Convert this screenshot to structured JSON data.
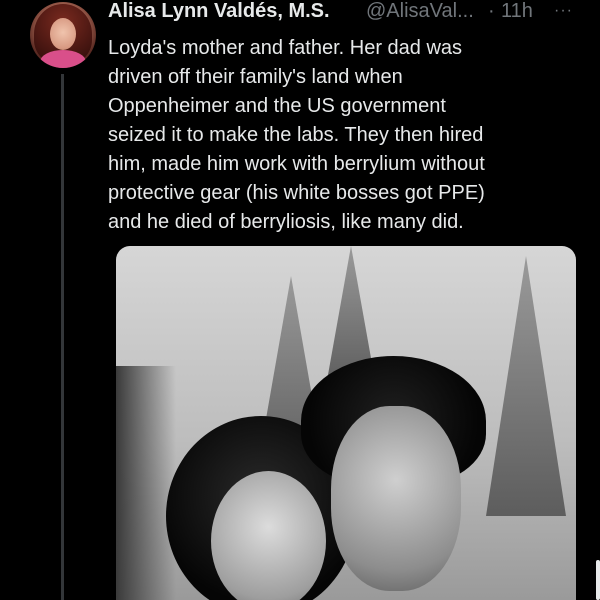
{
  "author": {
    "display_name": "Alisa Lynn Valdés, M.S.",
    "handle": "@AlisaVal...",
    "separator": "·",
    "time": "11h"
  },
  "menu": {
    "more_icon": "more-horizontal-icon",
    "more_label": "···"
  },
  "tweet": {
    "text_lines": [
      "Loyda's mother and father. Her dad was",
      "driven off their family's land when",
      "Oppenheimer and the US government",
      "seized it to make the labs. They then hired",
      "him, made him work with berrylium without",
      "protective gear (his white bosses got PPE)",
      "and he died of berryliosis, like many did."
    ]
  },
  "colors": {
    "background": "#000000",
    "primary_text": "#e7e9ea",
    "secondary_text": "#71767b",
    "thread_line": "#333639"
  }
}
